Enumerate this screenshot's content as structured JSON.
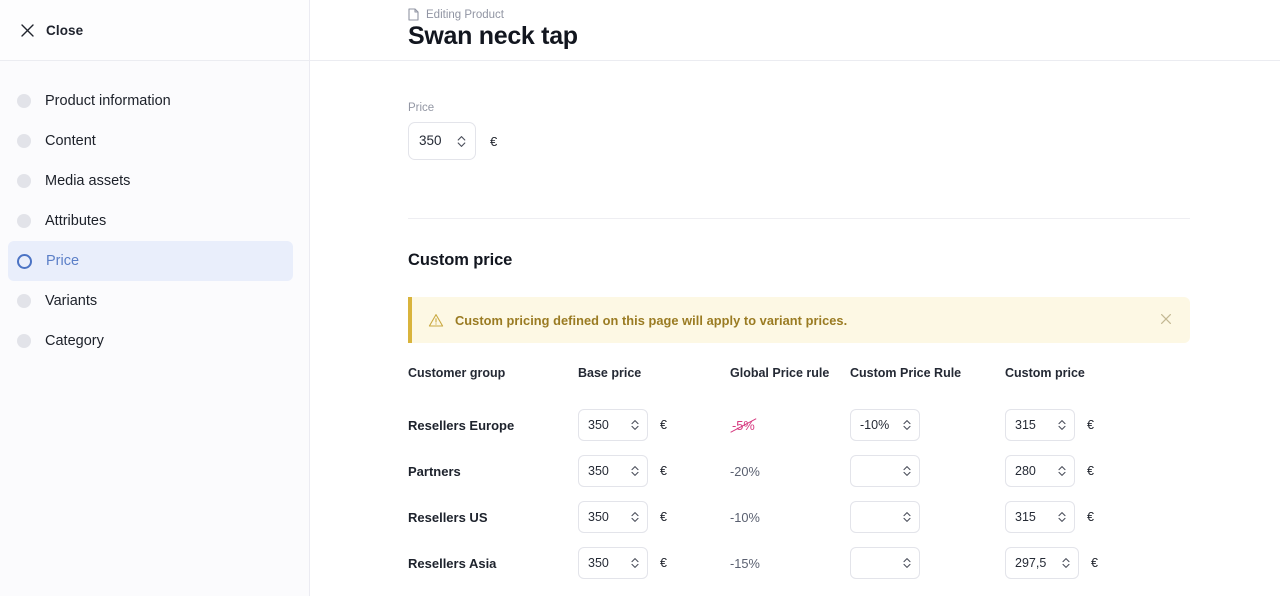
{
  "sidebar": {
    "close_label": "Close",
    "close_icon": "close-icon",
    "items": [
      {
        "label": "Product information",
        "icon": "dot-icon",
        "active": false
      },
      {
        "label": "Content",
        "icon": "dot-icon",
        "active": false
      },
      {
        "label": "Media assets",
        "icon": "dot-icon",
        "active": false
      },
      {
        "label": "Attributes",
        "icon": "dot-icon",
        "active": false
      },
      {
        "label": "Price",
        "icon": "ring-icon",
        "active": true
      },
      {
        "label": "Variants",
        "icon": "dot-icon",
        "active": false
      },
      {
        "label": "Category",
        "icon": "dot-icon",
        "active": false
      }
    ]
  },
  "header": {
    "eyebrow": "Editing Product",
    "eyebrow_icon": "document-icon",
    "title": "Swan neck tap"
  },
  "price_field": {
    "label": "Price",
    "value": "350",
    "currency": "€",
    "stepper_icon": "chevron-up-down-icon"
  },
  "custom_price": {
    "section_title": "Custom price",
    "banner": {
      "icon": "warning-triangle-icon",
      "text": "Custom pricing defined on this page will apply to variant prices.",
      "close_icon": "close-icon",
      "accent_color": "#d9b43c",
      "background_color": "#fdf8e4",
      "text_color": "#9a7b22"
    },
    "table": {
      "columns": [
        "Customer group",
        "Base price",
        "Global Price rule",
        "Custom Price Rule",
        "Custom price"
      ],
      "rows": [
        {
          "group": "Resellers Europe",
          "base_price": "350",
          "base_currency": "€",
          "global_rule": "-5%",
          "global_rule_struck": true,
          "custom_rule": "-10%",
          "custom_price": "315",
          "custom_currency": "€"
        },
        {
          "group": "Partners",
          "base_price": "350",
          "base_currency": "€",
          "global_rule": "-20%",
          "global_rule_struck": false,
          "custom_rule": "",
          "custom_price": "280",
          "custom_currency": "€"
        },
        {
          "group": "Resellers US",
          "base_price": "350",
          "base_currency": "€",
          "global_rule": "-10%",
          "global_rule_struck": false,
          "custom_rule": "",
          "custom_price": "315",
          "custom_currency": "€"
        },
        {
          "group": "Resellers Asia",
          "base_price": "350",
          "base_currency": "€",
          "global_rule": "-15%",
          "global_rule_struck": false,
          "custom_rule": "",
          "custom_price": "297,5",
          "custom_currency": "€"
        }
      ]
    }
  },
  "colors": {
    "accent_blue": "#5b7fc7",
    "active_bg": "#e9eefb",
    "strike_pink": "#d6397f",
    "warning_gold": "#d9b43c"
  }
}
